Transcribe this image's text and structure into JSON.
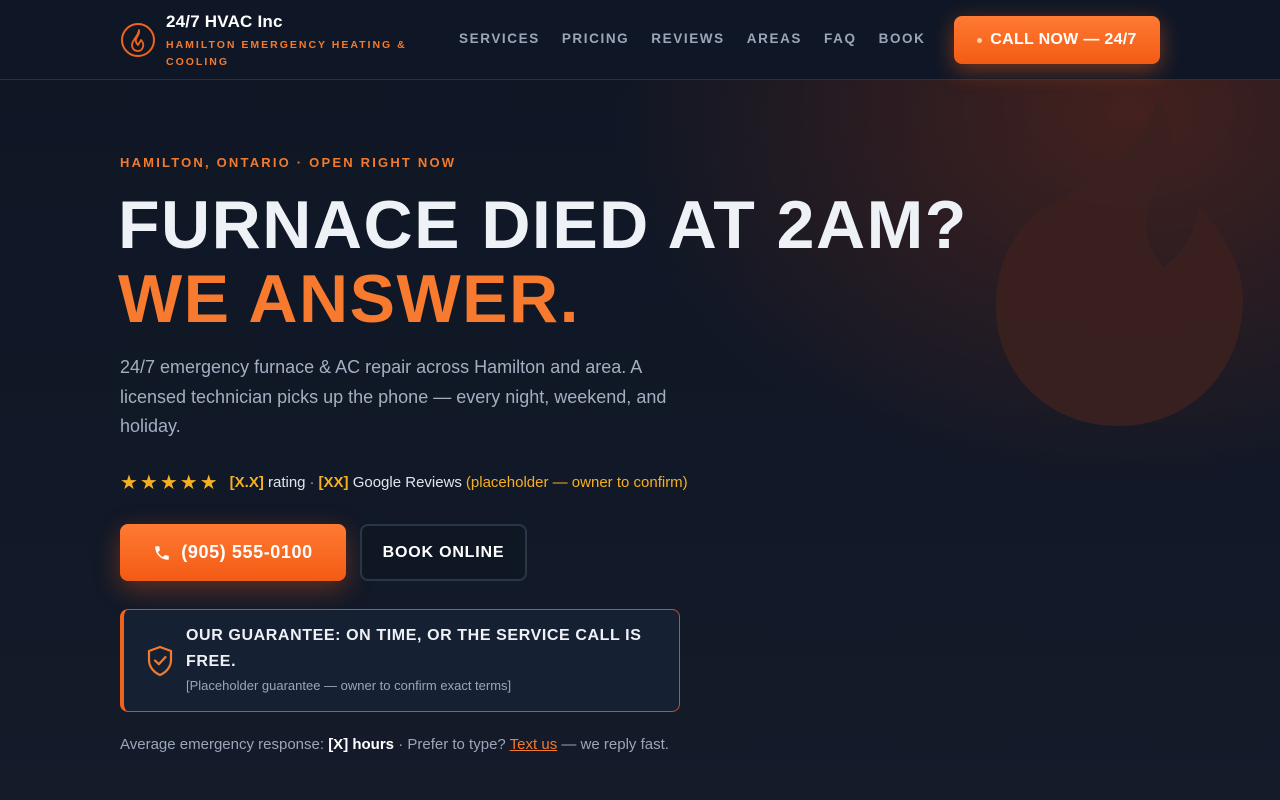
{
  "brand": {
    "name": "24/7 HVAC Inc",
    "tagline": "HAMILTON EMERGENCY HEATING & COOLING",
    "logo_icon": "flame-icon"
  },
  "nav": {
    "items": [
      {
        "label": "SERVICES"
      },
      {
        "label": "PRICING"
      },
      {
        "label": "REVIEWS"
      },
      {
        "label": "AREAS"
      },
      {
        "label": "FAQ"
      },
      {
        "label": "BOOK"
      }
    ]
  },
  "header_cta": {
    "label": "CALL NOW — 24/7"
  },
  "hero": {
    "eyebrow": "HAMILTON, ONTARIO · OPEN RIGHT NOW",
    "headline_line1": "FURNACE DIED AT 2AM?",
    "headline_line2": "WE ANSWER.",
    "subtext": "24/7 emergency furnace & AC repair across Hamilton and area. A licensed technician picks up the phone — every night, weekend, and holiday.",
    "background_icon": "flame-icon"
  },
  "rating": {
    "stars": "★★★★★",
    "score": "[X.X]",
    "score_suffix": "rating",
    "separator": "·",
    "count": "[XX]",
    "count_suffix": "Google Reviews",
    "note": "(placeholder — owner to confirm)"
  },
  "cta": {
    "phone_label": "(905) 555-0100",
    "phone_icon": "phone-icon",
    "book_label": "BOOK ONLINE"
  },
  "guarantee": {
    "title": "OUR GUARANTEE: ON TIME, OR THE SERVICE CALL IS FREE.",
    "note": "[Placeholder guarantee — owner to confirm exact terms]",
    "icon": "shield-check-icon"
  },
  "response": {
    "prefix": "Average emergency response:",
    "value": "[X] hours",
    "middle": "· Prefer to type?",
    "link": "Text us",
    "suffix": "— we reply fast."
  },
  "colors": {
    "accent": "#f77a2f",
    "background": "#111827",
    "star": "#f5b021"
  }
}
